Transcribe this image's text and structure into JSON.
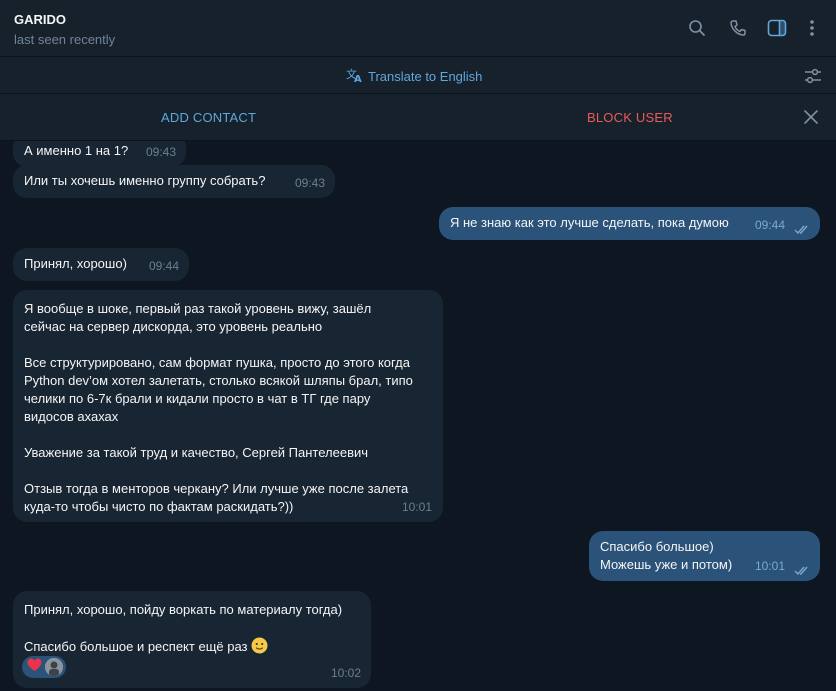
{
  "header": {
    "name": "GARIDO",
    "status": "last seen recently"
  },
  "translate": {
    "label": "Translate to English"
  },
  "actions": {
    "add_contact": "ADD CONTACT",
    "block_user": "BLOCK USER"
  },
  "messages": [
    {
      "dir": "in",
      "text": "А именно 1 на 1?",
      "time": "09:43"
    },
    {
      "dir": "in",
      "text": "Или ты хочешь именно группу собрать?",
      "time": "09:43"
    },
    {
      "dir": "out",
      "text": "Я не знаю как это лучше сделать, пока думою",
      "time": "09:44"
    },
    {
      "dir": "in",
      "text": "Принял, хорошо)",
      "time": "09:44"
    },
    {
      "dir": "in",
      "text": "Я вообще в шоке, первый раз такой уровень вижу, зашёл\nсейчас на сервер дискорда, это уровень реально\n\nВсе структурировано, сам формат пушка, просто до этого когда\nPython dev’ом хотел залетать, столько всякой шляпы брал, типо\nчелики по 6-7к брали и кидали просто в чат в ТГ где пару\nвидосов ахахах\n\nУважение за такой труд и качество, Сергей Пантелеевич\n\nОтзыв тогда в менторов черкану? Или лучше уже после залета\nкуда-то чтобы чисто по фактам раскидать?))",
      "time": "10:01"
    },
    {
      "dir": "out",
      "text": "Спасибо большое)\nМожешь уже и потом)",
      "time": "10:01"
    },
    {
      "dir": "in",
      "text": "Принял, хорошо, пойду воркать по материалу тогда)\n\nСпасибо большое и респект ещё раз",
      "emoji": "slightly-smiling-face",
      "time": "10:02",
      "reaction": "red-heart"
    }
  ],
  "colors": {
    "background": "#0e1621",
    "panel": "#17212b",
    "incoming": "#182533",
    "outgoing": "#2b5278",
    "accent": "#5ea7dd",
    "danger": "#e85b5b"
  }
}
